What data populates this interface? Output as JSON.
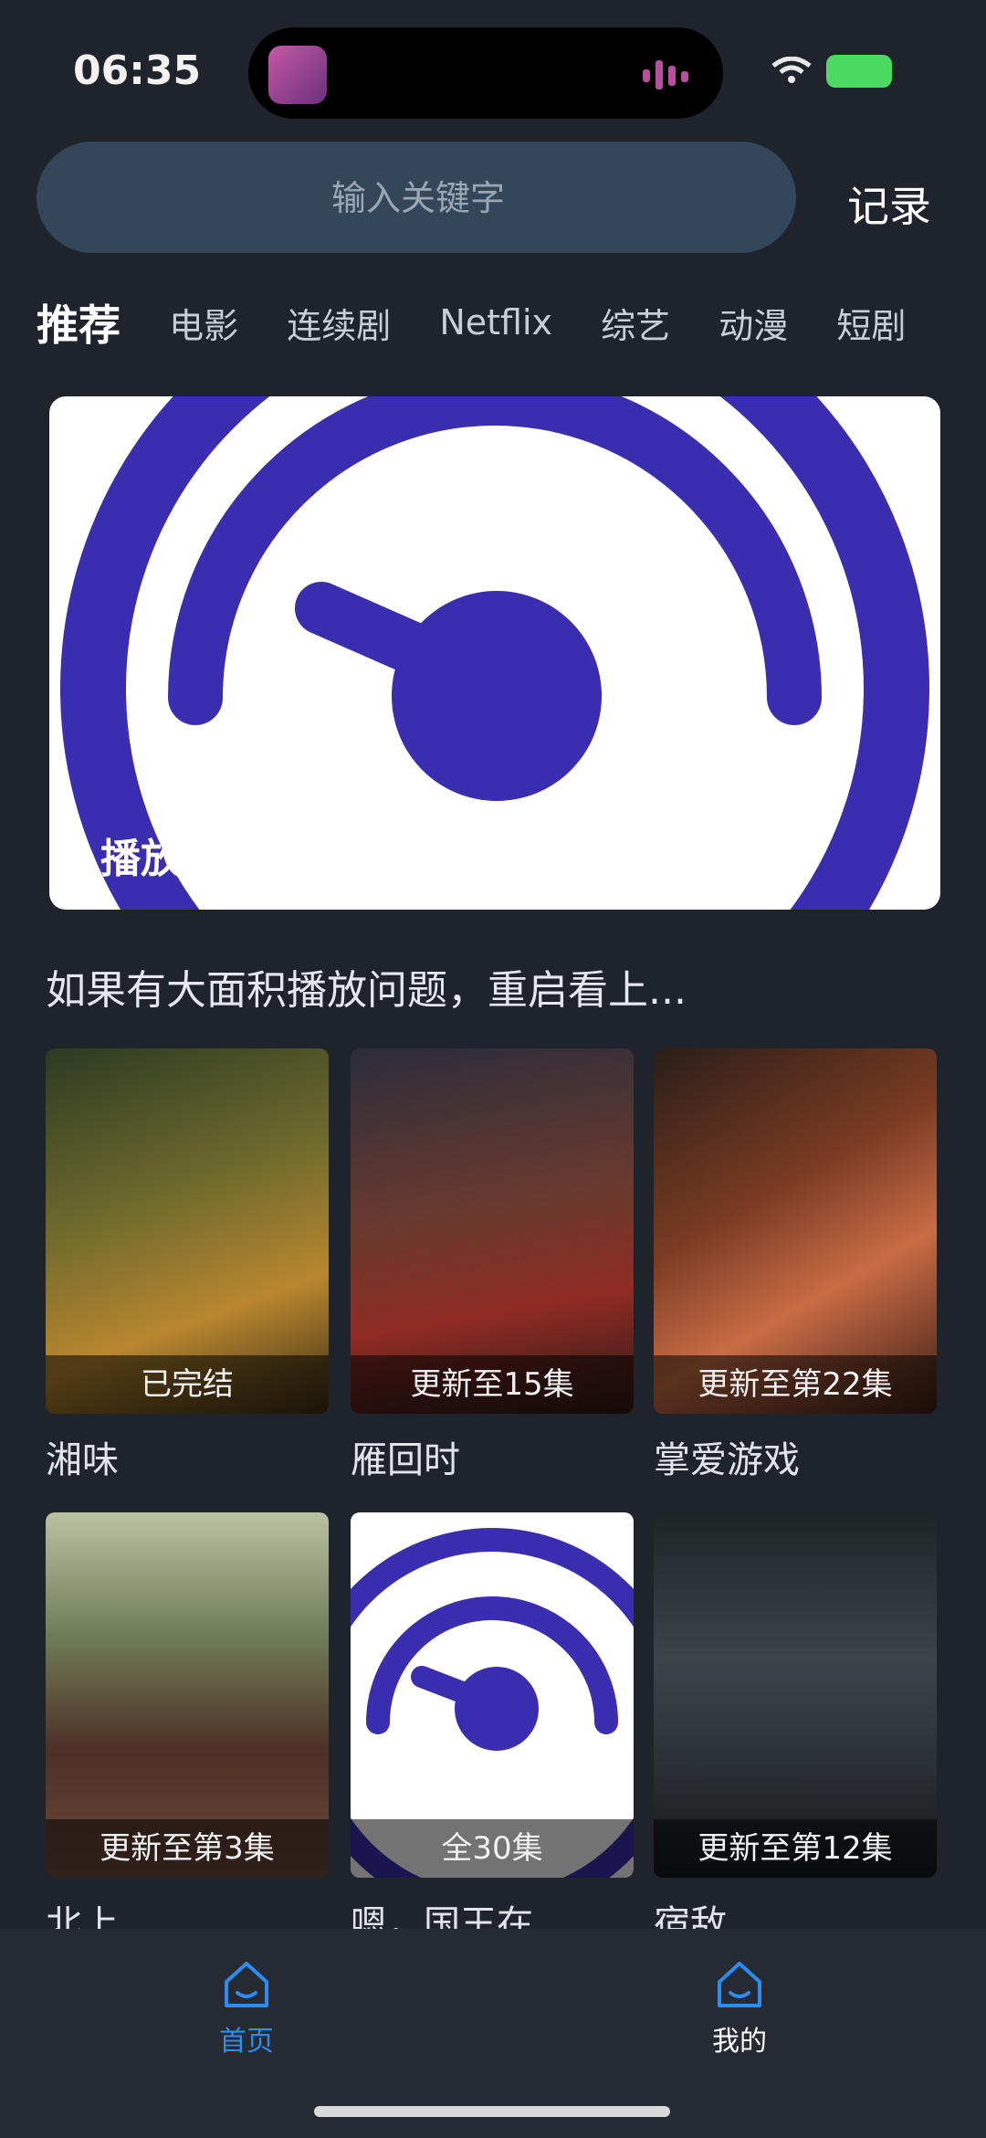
{
  "status_bar": {
    "time": "06:35"
  },
  "search": {
    "placeholder": "输入关键字",
    "record_label": "记录"
  },
  "tabs": [
    "推荐",
    "电影",
    "连续剧",
    "Netflix",
    "综艺",
    "动漫",
    "短剧"
  ],
  "banner": {
    "caption": "播放",
    "icon": "speedometer-logo-icon",
    "accent": "#3a2db0"
  },
  "notice": "如果有大面积播放问题，重启看上...",
  "cards": [
    {
      "label": "已完结",
      "title": "湘味"
    },
    {
      "label": "更新至15集",
      "title": "雁回时"
    },
    {
      "label": "更新至第22集",
      "title": "掌爱游戏"
    },
    {
      "label": "更新至第3集",
      "title": "北上"
    },
    {
      "label": "全30集",
      "title": "嗯，国王在..."
    },
    {
      "label": "更新至第12集",
      "title": "宿敌"
    }
  ],
  "nav": {
    "home_label": "首页",
    "mine_label": "我的",
    "active_color": "#2d8cf0"
  }
}
